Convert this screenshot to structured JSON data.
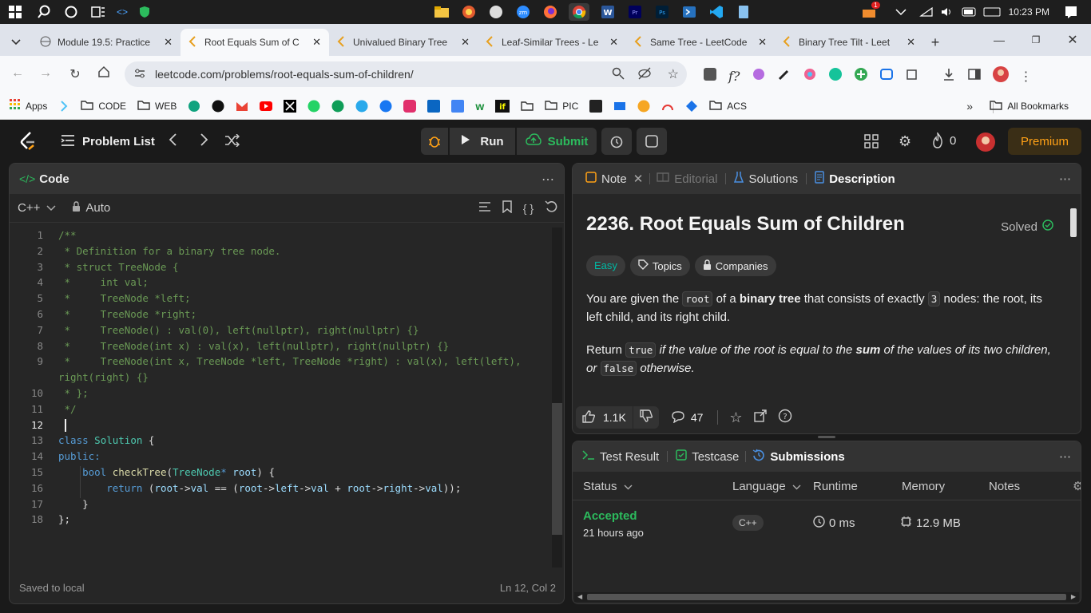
{
  "taskbar": {
    "time": "10:23 PM",
    "notification_badge": "1"
  },
  "tabs": [
    {
      "title": "Module 19.5: Practice",
      "active": false
    },
    {
      "title": "Root Equals Sum of C",
      "active": true
    },
    {
      "title": "Univalued Binary Tree",
      "active": false
    },
    {
      "title": "Leaf-Similar Trees - Le",
      "active": false
    },
    {
      "title": "Same Tree - LeetCode",
      "active": false
    },
    {
      "title": "Binary Tree Tilt - Leet",
      "active": false
    }
  ],
  "address_bar": {
    "url": "leetcode.com/problems/root-equals-sum-of-children/"
  },
  "bookmarks": [
    "Apps",
    "CODE",
    "WEB",
    "PIC",
    "ACS",
    "All Bookmarks"
  ],
  "lc_nav": {
    "problem_list": "Problem List",
    "run": "Run",
    "submit": "Submit",
    "streak": "0",
    "premium": "Premium"
  },
  "code_panel": {
    "title": "Code",
    "language": "C++",
    "mode": "Auto",
    "status_left": "Saved to local",
    "status_right": "Ln 12, Col 2",
    "lines": [
      {
        "n": "1",
        "t": "/**",
        "k": "cm"
      },
      {
        "n": "2",
        "t": " * Definition for a binary tree node.",
        "k": "cm"
      },
      {
        "n": "3",
        "t": " * struct TreeNode {",
        "k": "cm"
      },
      {
        "n": "4",
        "t": " *     int val;",
        "k": "cm"
      },
      {
        "n": "5",
        "t": " *     TreeNode *left;",
        "k": "cm"
      },
      {
        "n": "6",
        "t": " *     TreeNode *right;",
        "k": "cm"
      },
      {
        "n": "7",
        "t": " *     TreeNode() : val(0), left(nullptr), right(nullptr) {}",
        "k": "cm"
      },
      {
        "n": "8",
        "t": " *     TreeNode(int x) : val(x), left(nullptr), right(nullptr) {}",
        "k": "cm"
      },
      {
        "n": "9",
        "t": " *     TreeNode(int x, TreeNode *left, TreeNode *right) : val(x), left(left),",
        "k": "cm"
      },
      {
        "n": "",
        "t": "right(right) {}",
        "k": "cm"
      },
      {
        "n": "10",
        "t": " * };",
        "k": "cm"
      },
      {
        "n": "11",
        "t": " */",
        "k": "cm"
      },
      {
        "n": "12",
        "t": "",
        "k": "cur"
      },
      {
        "n": "13",
        "t": "class Solution {",
        "k": "c13"
      },
      {
        "n": "14",
        "t": "public:",
        "k": "kw"
      },
      {
        "n": "15",
        "t": "    bool checkTree(TreeNode* root) {",
        "k": "c15"
      },
      {
        "n": "16",
        "t": "        return (root->val == (root->left->val + root->right->val));",
        "k": "c16"
      },
      {
        "n": "17",
        "t": "    }",
        "k": "pl"
      },
      {
        "n": "18",
        "t": "};",
        "k": "pl"
      }
    ]
  },
  "desc_panel": {
    "tabs": [
      "Note",
      "Editorial",
      "Solutions",
      "Description"
    ],
    "title": "2236. Root Equals Sum of Children",
    "solved": "Solved",
    "difficulty": "Easy",
    "topics": "Topics",
    "companies": "Companies",
    "p1_a": "You are given the ",
    "p1_code1": "root",
    "p1_b": " of a ",
    "p1_bold": "binary tree",
    "p1_c": " that consists of exactly ",
    "p1_code2": "3",
    "p1_d": " nodes: the root, its left child, and its right child.",
    "p2_a": "Return ",
    "p2_code1": "true",
    "p2_b": " if the value of the root is equal to the ",
    "p2_bold": "sum",
    "p2_c": " of the values of its two children, or ",
    "p2_code2": "false",
    "p2_d": " otherwise.",
    "likes": "1.1K",
    "comments": "47"
  },
  "result_panel": {
    "tabs": [
      "Test Result",
      "Testcase",
      "Submissions"
    ],
    "columns": [
      "Status",
      "Language",
      "Runtime",
      "Memory",
      "Notes"
    ],
    "row": {
      "status": "Accepted",
      "time_ago": "21 hours ago",
      "language": "C++",
      "runtime": "0 ms",
      "memory": "12.9 MB"
    }
  },
  "colors": {
    "accepted": "#2cbb5d",
    "easy": "#00b8a3",
    "premium": "#ffa116",
    "submit": "#2cbb5d"
  }
}
